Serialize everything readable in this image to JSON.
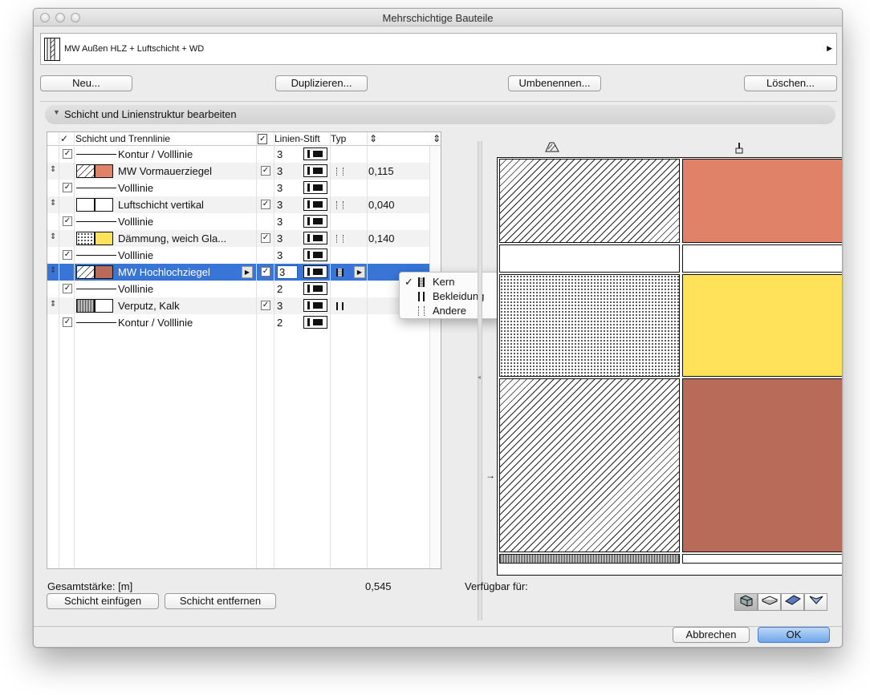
{
  "window": {
    "title": "Mehrschichtige Bauteile"
  },
  "composite": {
    "name": "MW Außen HLZ + Luftschicht + WD"
  },
  "toolbar": {
    "new_label": "Neu...",
    "duplicate_label": "Duplizieren...",
    "rename_label": "Umbenennen...",
    "delete_label": "Löschen..."
  },
  "section": {
    "title": "Schicht und Linienstruktur bearbeiten"
  },
  "table": {
    "headers": {
      "layer": "Schicht und Trennlinie",
      "pen": "Linien-Stift",
      "type": "Typ"
    },
    "rows": [
      {
        "kind": "line",
        "checked": true,
        "name": "Kontur /  Volllinie",
        "pen": "3"
      },
      {
        "kind": "layer",
        "name": "MW Vormauerziegel",
        "fill": "#e08268",
        "hatch": "diag",
        "checked": true,
        "pen": "3",
        "typ": "other",
        "thickness": "0,115"
      },
      {
        "kind": "line",
        "checked": true,
        "name": "Volllinie",
        "pen": "3"
      },
      {
        "kind": "layer",
        "name": "Luftschicht vertikal",
        "fill": "#ffffff",
        "hatch": "none",
        "checked": true,
        "pen": "3",
        "typ": "other",
        "thickness": "0,040"
      },
      {
        "kind": "line",
        "checked": true,
        "name": "Volllinie",
        "pen": "3"
      },
      {
        "kind": "layer",
        "name": "Dämmung, weich Gla...",
        "fill": "#ffe15a",
        "hatch": "dots",
        "checked": true,
        "pen": "3",
        "typ": "other",
        "thickness": "0,140"
      },
      {
        "kind": "line",
        "checked": true,
        "name": "Volllinie",
        "pen": "3"
      },
      {
        "kind": "layer",
        "name": "MW Hochlochziegel",
        "fill": "#b76b58",
        "hatch": "diag",
        "checked": true,
        "pen": "3",
        "typ": "kern",
        "thickness": "",
        "selected": true
      },
      {
        "kind": "line",
        "checked": true,
        "name": "Volllinie",
        "pen": "2"
      },
      {
        "kind": "layer",
        "name": "Verputz, Kalk",
        "fill": "#ffffff",
        "hatch": "fine",
        "checked": true,
        "pen": "3",
        "typ": "solid",
        "thickness": ""
      },
      {
        "kind": "line",
        "checked": true,
        "name": "Kontur /  Volllinie",
        "pen": "2"
      }
    ]
  },
  "type_menu": {
    "items": [
      {
        "label": "Kern",
        "checked": true,
        "icon": "core-icon"
      },
      {
        "label": "Bekleidung",
        "checked": false,
        "icon": "finish-icon"
      },
      {
        "label": "Andere",
        "checked": false,
        "icon": "other-icon"
      }
    ]
  },
  "totals": {
    "label": "Gesamtstärke: [m]",
    "value": "0,545"
  },
  "layer_buttons": {
    "insert_label": "Schicht einfügen",
    "remove_label": "Schicht entfernen"
  },
  "preview": {
    "available_label": "Verfügbar für:",
    "layers": [
      {
        "hatch": "diag",
        "fill": "#e08268",
        "thickness": 0.115
      },
      {
        "hatch": "none",
        "fill": "#ffffff",
        "thickness": 0.04
      },
      {
        "hatch": "dots",
        "fill": "#ffe15a",
        "thickness": 0.14
      },
      {
        "hatch": "diag",
        "fill": "#b76b58",
        "thickness": 0.235
      },
      {
        "hatch": "fine",
        "fill": "#ffffff",
        "thickness": 0.015
      }
    ]
  },
  "available_for": [
    "wall-icon",
    "slab-icon",
    "roof-icon",
    "shell-icon"
  ],
  "footer": {
    "cancel_label": "Abbrechen",
    "ok_label": "OK"
  },
  "colors": {
    "selection": "#3875d7",
    "primary_button": "#6fa6ea"
  }
}
